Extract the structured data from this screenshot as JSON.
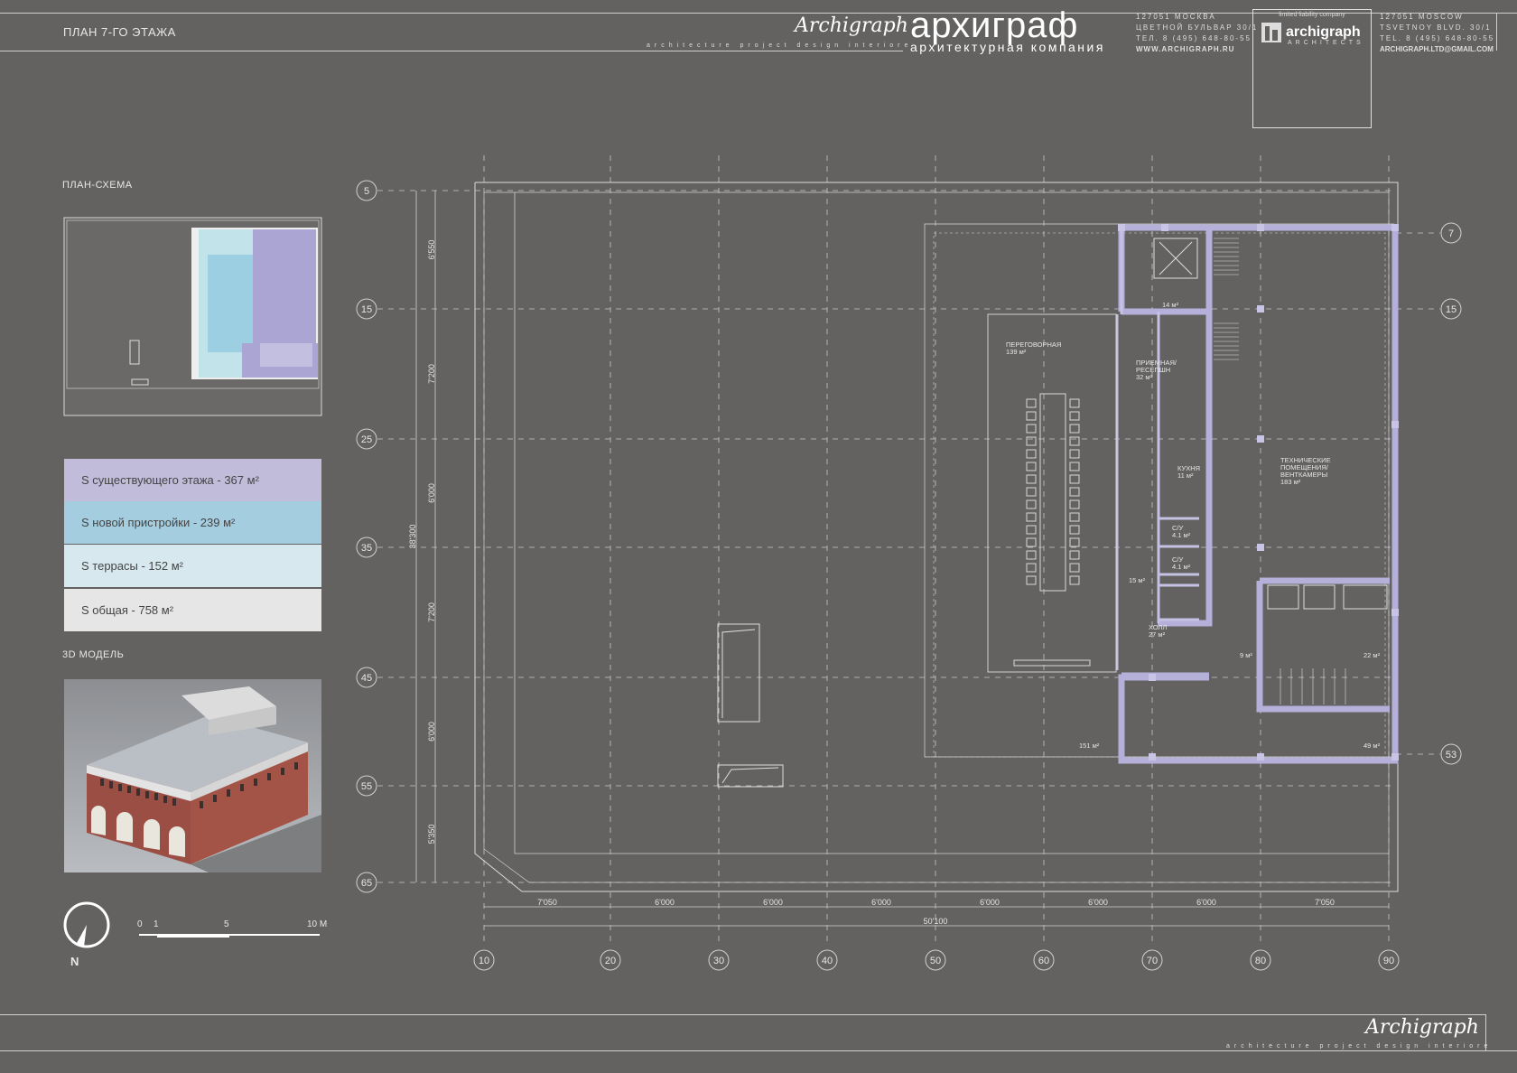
{
  "sheet_title": "ПЛАН 7-ГО ЭТАЖА",
  "header": {
    "logo_script": "Archigraph",
    "tagline": "architecture  project  design  interiore",
    "brand_name": "архиграф",
    "brand_subtitle": "архитектурная компания",
    "address_ru": [
      "127051 МОСКВА",
      "ЦВЕТНОЙ БУЛЬВАР 30/1",
      "ТЕЛ. 8 (495) 648-80-55",
      "WWW.ARCHIGRAPH.RU"
    ],
    "box_top": "limited liability company",
    "box_brand": "archigraph",
    "box_sub": "ARCHITECTS",
    "address_en": [
      "127051 MOSCOW",
      "TSVETNOY BLVD. 30/1",
      "TEL. 8 (495) 648-80-55",
      "ARCHIGRAPH.LTD@GMAIL.COM"
    ]
  },
  "left_panel": {
    "scheme_label": "ПЛАН-СХЕМА",
    "model_label": "3D МОДЕЛЬ",
    "areas": [
      {
        "text": "S существующего этажа - 367 м²",
        "color": "#c0bcd9"
      },
      {
        "text": "S новой пристройки - 239 м²",
        "color": "#a5cde0"
      },
      {
        "text": "S террасы - 152 м²",
        "color": "#d7e8ee"
      },
      {
        "text": "S общая -  758  м²",
        "color": "#e6e6e6"
      }
    ],
    "north_label": "N",
    "scale_labels": [
      "0",
      "1",
      "5",
      "10 M"
    ]
  },
  "plan": {
    "row_axes": [
      "5",
      "15",
      "25",
      "35",
      "45",
      "55",
      "65"
    ],
    "right_row_axes": [
      "7",
      "15",
      "53"
    ],
    "col_axes": [
      "10",
      "20",
      "30",
      "40",
      "50",
      "60",
      "70",
      "80",
      "90"
    ],
    "col_dims": [
      "7'050",
      "6'000",
      "6'000",
      "6'000",
      "6'000",
      "6'000",
      "6'000",
      "7'050"
    ],
    "total_width": "50'100",
    "row_dims": [
      "6'550",
      "7'200",
      "6'000",
      "7'200",
      "6'000",
      "5'350"
    ],
    "total_height": "38'300",
    "rooms": [
      {
        "name": "ПЕРЕГОВОРНАЯ",
        "area": "139 м²"
      },
      {
        "name": "ПРИЕМНАЯ/ РЕСЕПШН",
        "area": "32 м²"
      },
      {
        "name": "КУХНЯ",
        "area": "11 м²"
      },
      {
        "name": "С/У",
        "area": "4.1 м²"
      },
      {
        "name": "С/У",
        "area": "4.1 м²"
      },
      {
        "name": "ХОЛЛ",
        "area": "27 м²"
      },
      {
        "name": "ТЕХНИЧЕСКИЕ ПОМЕЩЕНИЯ/ ВЕНТКАМЕРЫ",
        "area": "183 м²"
      },
      {
        "name": "",
        "area": "14 м²"
      },
      {
        "name": "",
        "area": "15 м²"
      },
      {
        "name": "",
        "area": "9 м²"
      },
      {
        "name": "",
        "area": "22 м²"
      },
      {
        "name": "",
        "area": "151 м²"
      },
      {
        "name": "",
        "area": "49 м²"
      }
    ]
  },
  "footer": {
    "logo_script": "Archigraph",
    "tagline": "architecture  project  design  interiore"
  }
}
